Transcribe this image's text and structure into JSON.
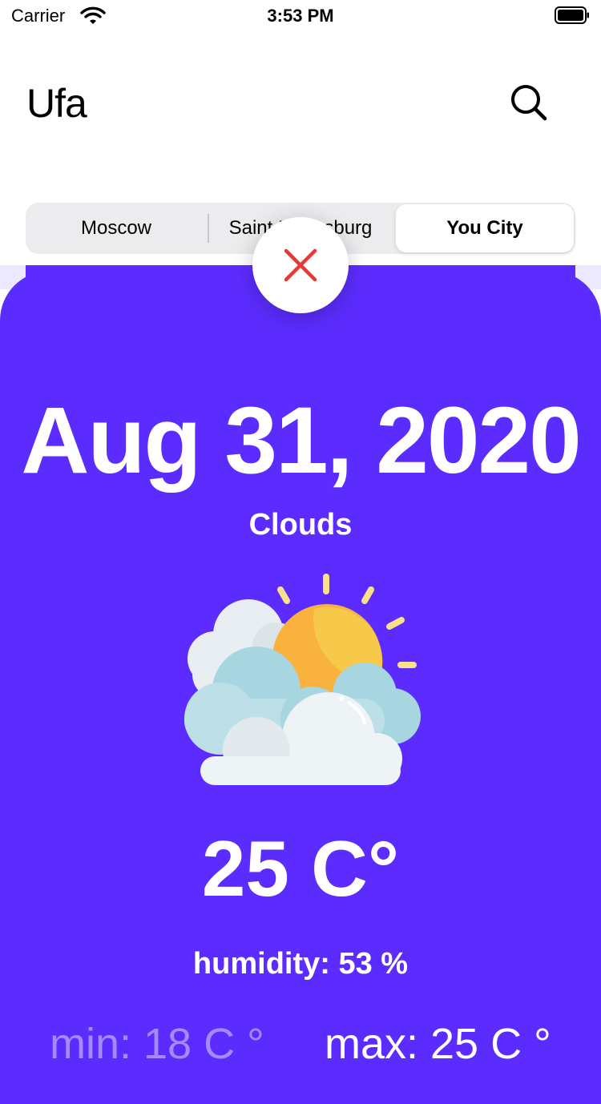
{
  "status_bar": {
    "carrier": "Carrier",
    "time": "3:53 PM"
  },
  "header": {
    "city": "Ufa",
    "search_icon": "search-icon"
  },
  "segments": [
    {
      "label": "Moscow",
      "selected": false
    },
    {
      "label": "Saint Petersburg",
      "selected": false
    },
    {
      "label": "You City",
      "selected": true
    }
  ],
  "weather": {
    "date": "Aug 31, 2020",
    "condition": "Clouds",
    "icon": "sun-behind-clouds-icon",
    "temperature": "25 C°",
    "humidity": "humidity: 53 %",
    "min": "min: 18 C °",
    "max": "max: 25 C °"
  },
  "colors": {
    "card": "#5c2cff",
    "close_x": "#e53935",
    "min_text": "#a38bff"
  }
}
